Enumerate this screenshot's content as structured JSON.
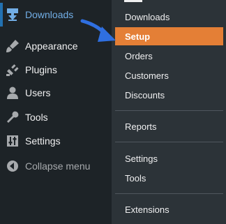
{
  "sidebar": {
    "items": [
      {
        "label": "Downloads",
        "icon": "download-icon"
      },
      {
        "label": "Appearance",
        "icon": "brush-icon"
      },
      {
        "label": "Plugins",
        "icon": "plug-icon"
      },
      {
        "label": "Users",
        "icon": "user-icon"
      },
      {
        "label": "Tools",
        "icon": "wrench-icon"
      },
      {
        "label": "Settings",
        "icon": "sliders-icon"
      }
    ],
    "collapse_label": "Collapse menu",
    "collapse_icon": "collapse-arrow-icon"
  },
  "submenu": {
    "items": [
      {
        "label": "Downloads"
      },
      {
        "label": "Setup"
      },
      {
        "label": "Orders"
      },
      {
        "label": "Customers"
      },
      {
        "label": "Discounts"
      },
      {
        "label": "Reports"
      },
      {
        "label": "Settings"
      },
      {
        "label": "Tools"
      },
      {
        "label": "Extensions"
      }
    ]
  },
  "colors": {
    "sidebar_bg": "#1d2327",
    "submenu_bg": "#2c3338",
    "active_text": "#72aee6",
    "highlight": "#e47f36",
    "arrow": "#2f6fe0"
  }
}
